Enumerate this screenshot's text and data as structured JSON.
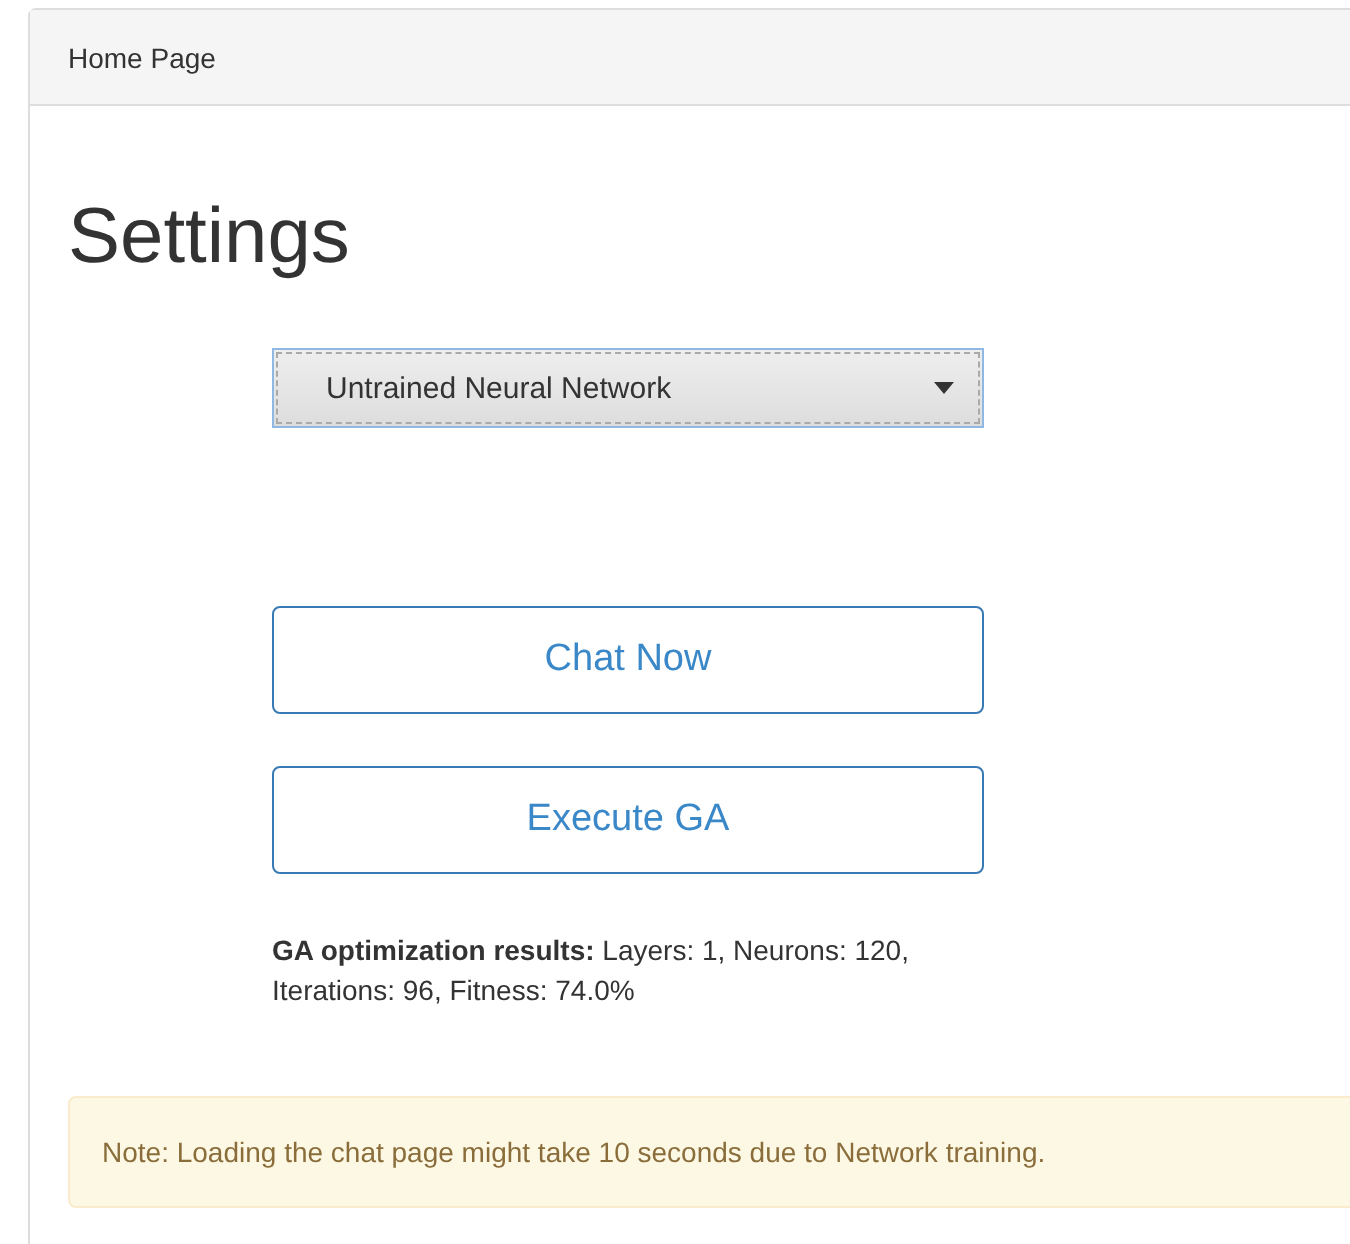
{
  "panel": {
    "heading": "Home Page"
  },
  "title": "Settings",
  "network_select": {
    "value": "Untrained Neural Network"
  },
  "buttons": [
    "Chat Now",
    "Execute GA"
  ],
  "results": "**GA optimization results:** Layers: 1, Neurons: 120, Iterations: 96, Fitness: 74.0%",
  "note": "Note: Loading the chat page might take 10 seconds due to Network training."
}
